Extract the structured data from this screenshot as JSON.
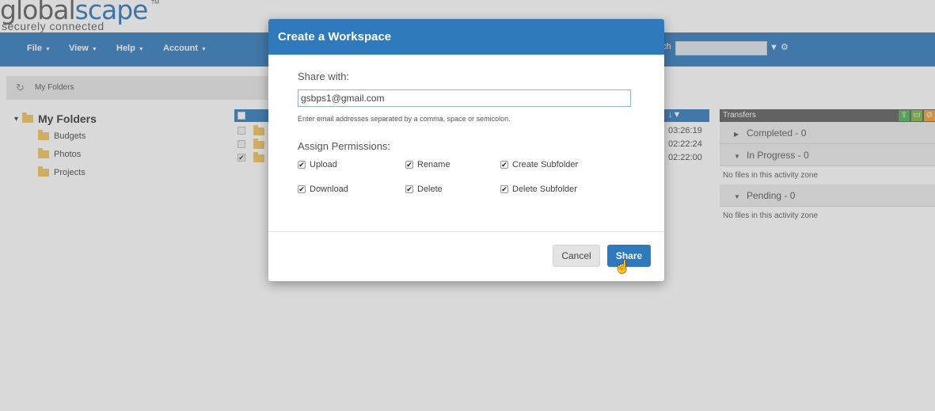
{
  "logo": {
    "main_part1": "global",
    "main_part2": "scape",
    "tagline": "securely connected",
    "tm": "TM"
  },
  "nav": {
    "items": [
      {
        "label": "File"
      },
      {
        "label": "View"
      },
      {
        "label": "Help"
      },
      {
        "label": "Account"
      }
    ],
    "search_label": "ch"
  },
  "breadcrumb": {
    "label": "My Folders"
  },
  "tree": {
    "root": "My Folders",
    "children": [
      {
        "label": "Budgets"
      },
      {
        "label": "Photos"
      },
      {
        "label": "Projects"
      }
    ]
  },
  "filelist": {
    "rows": [
      {
        "checked": false,
        "time": "03:26:19"
      },
      {
        "checked": false,
        "time": "02:22:24"
      },
      {
        "checked": true,
        "time": "02:22:00"
      }
    ]
  },
  "transfers": {
    "title": "Transfers",
    "completed": "Completed - 0",
    "in_progress": "In Progress - 0",
    "in_progress_empty": "No files in this activity zone",
    "pending": "Pending - 0",
    "pending_empty": "No files in this activity zone"
  },
  "modal": {
    "title": "Create a Workspace",
    "share_with_label": "Share with:",
    "email_value": "gsbps1@gmail.com",
    "hint": "Enter email addresses separated by a comma, space or semicolon.",
    "permissions_label": "Assign Permissions:",
    "permissions": [
      {
        "label": "Upload",
        "checked": true
      },
      {
        "label": "Rename",
        "checked": true
      },
      {
        "label": "Create Subfolder",
        "checked": true
      },
      {
        "label": "Download",
        "checked": true
      },
      {
        "label": "Delete",
        "checked": true
      },
      {
        "label": "Delete Subfolder",
        "checked": true
      }
    ],
    "cancel_label": "Cancel",
    "share_label": "Share"
  },
  "colors": {
    "brand_blue": "#2f79bd",
    "folder": "#f1c25a"
  },
  "icons": {
    "refresh": "refresh-icon",
    "filter": "filter-icon",
    "gear": "gear-icon",
    "cursor": "hand-cursor-icon"
  }
}
